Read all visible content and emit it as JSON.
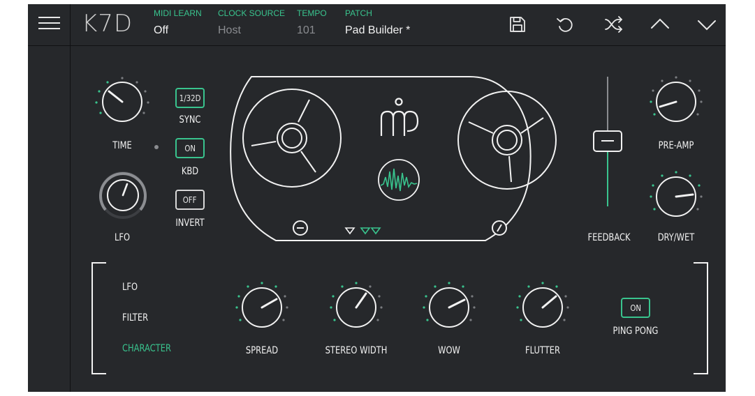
{
  "app": {
    "logo": "K7D",
    "accent_color": "#39c48e",
    "background_color": "#26282b"
  },
  "header": {
    "menu_icon": "hamburger-menu-icon",
    "fields": [
      {
        "label": "MIDI LEARN",
        "value": "Off"
      },
      {
        "label": "CLOCK SOURCE",
        "value": "Host"
      },
      {
        "label": "TEMPO",
        "value": "101"
      },
      {
        "label": "PATCH",
        "value": "Pad Builder *"
      }
    ],
    "actions": [
      "save-icon",
      "undo-icon",
      "shuffle-icon",
      "chevron-up-icon",
      "chevron-down-icon"
    ]
  },
  "controls": {
    "time_label": "TIME",
    "lfo_label": "LFO",
    "sync": {
      "value": "1/32D",
      "label": "SYNC"
    },
    "kbd": {
      "value": "ON",
      "label": "KBD"
    },
    "invert": {
      "value": "OFF",
      "label": "INVERT"
    },
    "feedback_label": "FEEDBACK",
    "preamp_label": "PRE-AMP",
    "drywet_label": "DRY/WET"
  },
  "tabs": [
    {
      "label": "LFO",
      "active": false
    },
    {
      "label": "FILTER",
      "active": false
    },
    {
      "label": "CHARACTER",
      "active": true
    }
  ],
  "character": {
    "knobs": [
      "SPREAD",
      "STEREO WIDTH",
      "WOW",
      "FLUTTER"
    ],
    "ping_pong": {
      "value": "ON",
      "label": "PING PONG"
    }
  }
}
